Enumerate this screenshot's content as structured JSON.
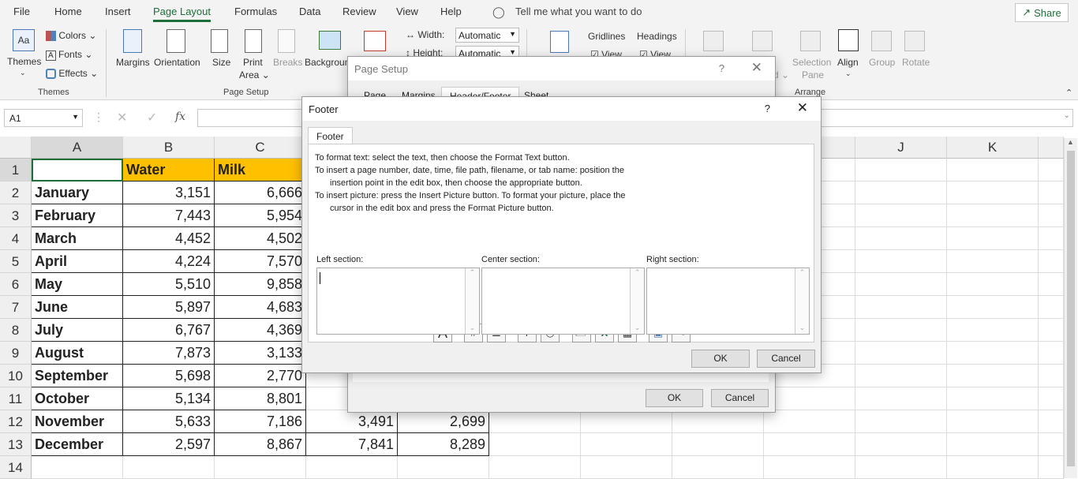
{
  "tabs": [
    "File",
    "Home",
    "Insert",
    "Page Layout",
    "Formulas",
    "Data",
    "Review",
    "View",
    "Help"
  ],
  "tell_me": "Tell me what you want to do",
  "share": "Share",
  "ribbon": {
    "themes": "Themes",
    "colors": "Colors",
    "fonts": "Fonts",
    "effects": "Effects",
    "margins": "Margins",
    "orientation": "Orientation",
    "size": "Size",
    "print_area_1": "Print",
    "print_area_2": "Area",
    "breaks": "Breaks",
    "background": "Backgroun",
    "width_label": "Width:",
    "width_val": "Automatic",
    "height_label": "Height:",
    "height_val": "Automatic",
    "gridlines": "Gridlines",
    "headings": "Headings",
    "view1": "View",
    "view2": "View",
    "sel_pane_1": "Selection",
    "sel_pane_2": "Pane",
    "align": "Align",
    "group": "Group",
    "rotate": "Rotate",
    "group_themes": "Themes",
    "group_page_setup": "Page Setup",
    "group_arrange": "Arrange"
  },
  "namebox": "A1",
  "columns": [
    "A",
    "B",
    "C",
    "J",
    "K"
  ],
  "rows": [
    {
      "n": "1",
      "a": "",
      "b": "Water",
      "c": "Milk",
      "e": "",
      "f": ""
    },
    {
      "n": "2",
      "a": "January",
      "b": "3,151",
      "c": "6,666",
      "e": "",
      "f": ""
    },
    {
      "n": "3",
      "a": "February",
      "b": "7,443",
      "c": "5,954",
      "e": "",
      "f": ""
    },
    {
      "n": "4",
      "a": "March",
      "b": "4,452",
      "c": "4,502",
      "e": "",
      "f": ""
    },
    {
      "n": "5",
      "a": "April",
      "b": "4,224",
      "c": "7,570",
      "e": "",
      "f": ""
    },
    {
      "n": "6",
      "a": "May",
      "b": "5,510",
      "c": "9,858",
      "e": "",
      "f": ""
    },
    {
      "n": "7",
      "a": "June",
      "b": "5,897",
      "c": "4,683",
      "e": "",
      "f": ""
    },
    {
      "n": "8",
      "a": "July",
      "b": "6,767",
      "c": "4,369",
      "e": "",
      "f": ""
    },
    {
      "n": "9",
      "a": "August",
      "b": "7,873",
      "c": "3,133",
      "e": "",
      "f": ""
    },
    {
      "n": "10",
      "a": "September",
      "b": "5,698",
      "c": "2,770",
      "e": "",
      "f": ""
    },
    {
      "n": "11",
      "a": "October",
      "b": "5,134",
      "c": "8,801",
      "e": "",
      "f": ""
    },
    {
      "n": "12",
      "a": "November",
      "b": "5,633",
      "c": "7,186",
      "e": "3,491",
      "f": "2,699"
    },
    {
      "n": "13",
      "a": "December",
      "b": "2,597",
      "c": "8,867",
      "e": "7,841",
      "f": "8,289"
    },
    {
      "n": "14",
      "a": "",
      "b": "",
      "c": "",
      "e": "",
      "f": ""
    }
  ],
  "page_setup": {
    "title": "Page Setup",
    "help": "?",
    "tabs": [
      "Page",
      "Margins",
      "Header/Footer",
      "Sheet"
    ],
    "ok": "OK",
    "cancel": "Cancel"
  },
  "footer_dialog": {
    "title": "Footer",
    "help": "?",
    "tab": "Footer",
    "instructions": [
      "To format text:  select the text, then choose the Format Text button.",
      "To insert a page number, date, time, file path, filename, or tab name:  position the",
      "insertion point in the edit box, then choose the appropriate button.",
      "To insert picture: press the Insert Picture button.  To format your picture, place the",
      "cursor in the edit box and press the Format Picture button."
    ],
    "left_section": "Left section:",
    "center_section": "Center section:",
    "right_section": "Right section:",
    "ok": "OK",
    "cancel": "Cancel"
  }
}
